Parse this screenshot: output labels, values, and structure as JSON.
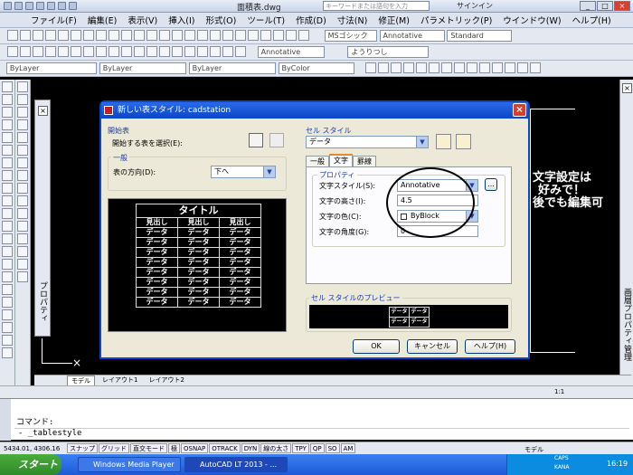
{
  "titlebar": {
    "title": "面積表.dwg",
    "search_placeholder": "キーワードまたは語句を入力",
    "signin": "サインイン"
  },
  "menu": [
    "ファイル(F)",
    "編集(E)",
    "表示(V)",
    "挿入(I)",
    "形式(O)",
    "ツール(T)",
    "作成(D)",
    "寸法(N)",
    "修正(M)",
    "パラメトリック(P)",
    "ウインドウ(W)",
    "ヘルプ(H)"
  ],
  "toolbar": {
    "textstyle": "MSゴシック",
    "annotative": "Annotative",
    "standard": "Standard",
    "layer": "ByLayer",
    "color": "ByColor",
    "linetype": "ByLayer",
    "lineweight": "ByLayer",
    "layer_name": "0",
    "textstyle2": "ようりつし"
  },
  "dialog": {
    "title": "新しい表スタイル: cadstation",
    "start_group": "開始表",
    "start_label": "開始する表を選択(E):",
    "general_group": "一般",
    "direction_label": "表の方向(D):",
    "direction_value": "下へ",
    "cell_style_group": "セル スタイル",
    "cell_style_value": "データ",
    "tabs": [
      "一般",
      "文字",
      "罫線"
    ],
    "props_group": "プロパティ",
    "text_style_label": "文字スタイル(S):",
    "text_style_value": "Annotative",
    "text_height_label": "文字の高さ(I):",
    "text_height_value": "4.5",
    "text_color_label": "文字の色(C):",
    "text_color_value": "ByBlock",
    "text_angle_label": "文字の角度(G):",
    "text_angle_value": "0",
    "cell_preview_group": "セル スタイルのプレビュー",
    "preview_cell": "データ",
    "ok": "OK",
    "cancel": "キャンセル",
    "help": "ヘルプ(H)",
    "browse": "..."
  },
  "preview_table": {
    "title": "タイトル",
    "headers": [
      "見出し",
      "見出し",
      "見出し"
    ],
    "cell": "データ",
    "rows": 8
  },
  "annotation": [
    "文字設定は",
    "好みで！",
    "後でも編集可"
  ],
  "properties_palette": "プロパティ",
  "right_palette": "画層プロパティ管理",
  "layout_tabs": [
    "モデル",
    "レイアウト1",
    "レイアウト2"
  ],
  "command": {
    "label": "コマンド:",
    "history": "- _tablestyle"
  },
  "status": {
    "coords": "5434.01, 4306.16",
    "toggles": [
      "スナップ",
      "グリッド",
      "直交モード",
      "極",
      "OSNAP",
      "OTRACK",
      "DYN",
      "線の太さ",
      "TPY",
      "QP",
      "SO",
      "AM"
    ],
    "model": "モデル",
    "scale": "1:1"
  },
  "taskbar": {
    "start": "スタート",
    "tasks": [
      "Windows Media Player",
      "AutoCAD LT 2013 - ..."
    ],
    "caps": "CAPS",
    "kana": "KANA",
    "clock": "16:19"
  }
}
